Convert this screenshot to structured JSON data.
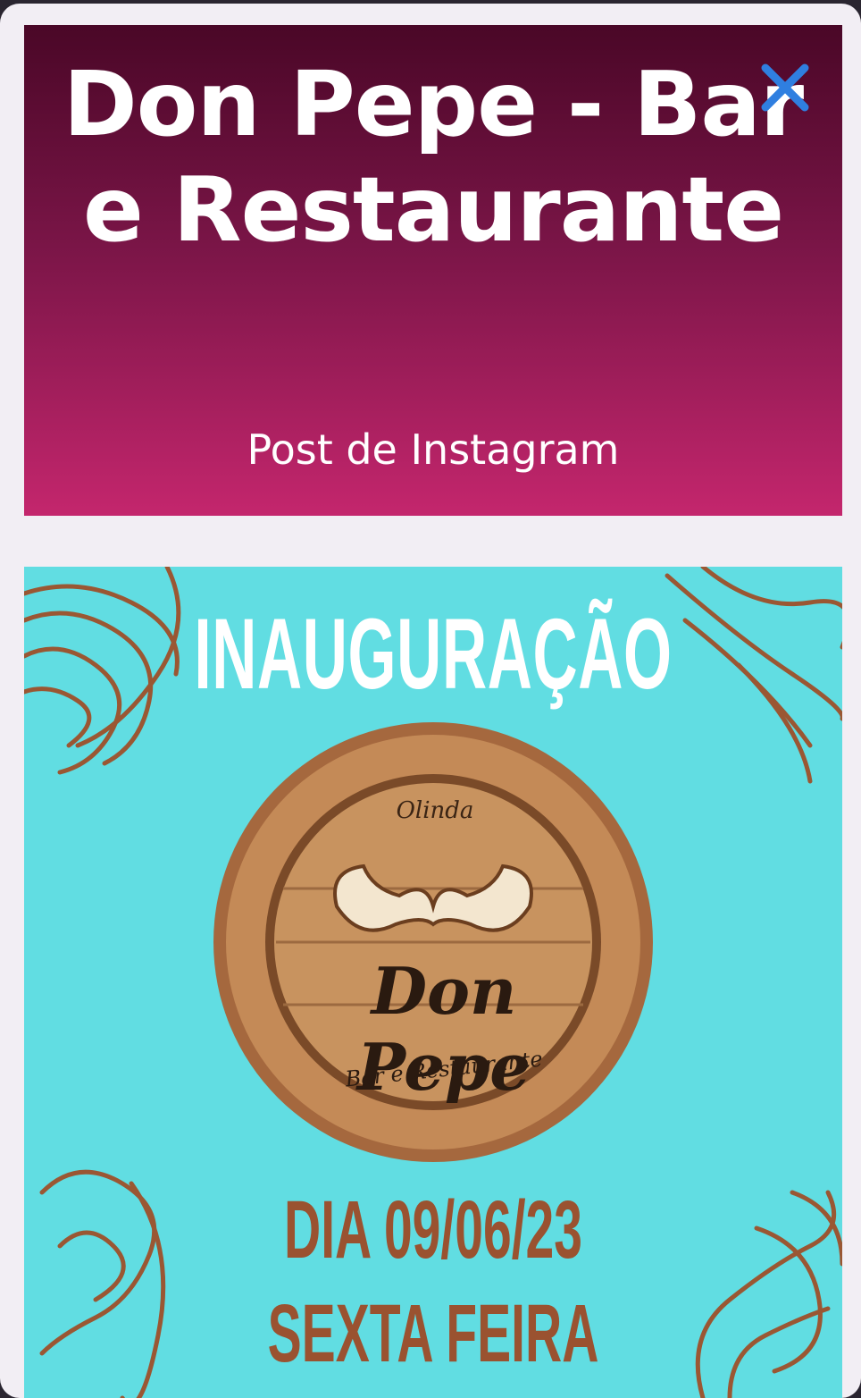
{
  "header": {
    "title": "Don Pepe - Bar e Restaurante",
    "subtitle": "Post de Instagram",
    "close_icon": "close-icon",
    "colors": {
      "gradient_top": "#4a0727",
      "gradient_bottom": "#c4266d",
      "close": "#2f7fe0"
    }
  },
  "post": {
    "headline": "INAUGURAÇÃO",
    "logo": {
      "city": "Olinda",
      "name": "Don Pepe",
      "tagline": "Bar e Restaurante",
      "icon": "mustache-icon"
    },
    "date": "DIA 09/06/23",
    "weekday": "SEXTA FEIRA",
    "colors": {
      "background": "#61dde2",
      "accent": "#9a5230"
    }
  }
}
